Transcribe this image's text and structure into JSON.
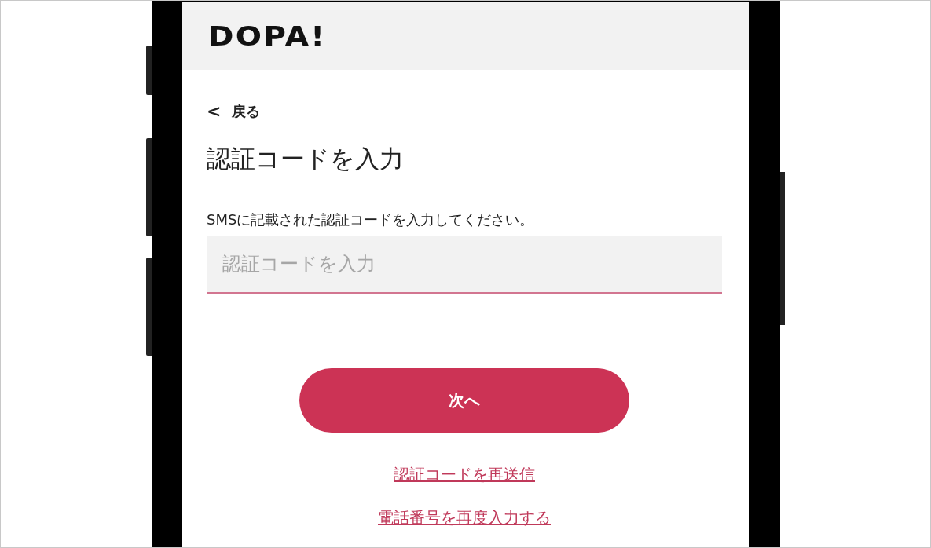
{
  "header": {
    "logo": "DOPA!"
  },
  "back_link": {
    "icon": "<",
    "label": "戻る"
  },
  "title": "認証コードを入力",
  "instruction": "SMSに記載された認証コードを入力してください。",
  "code_field": {
    "placeholder": "認証コードを入力"
  },
  "next_button": "次へ",
  "links": [
    "認証コードを再送信",
    "電話番号を再度入力する"
  ]
}
